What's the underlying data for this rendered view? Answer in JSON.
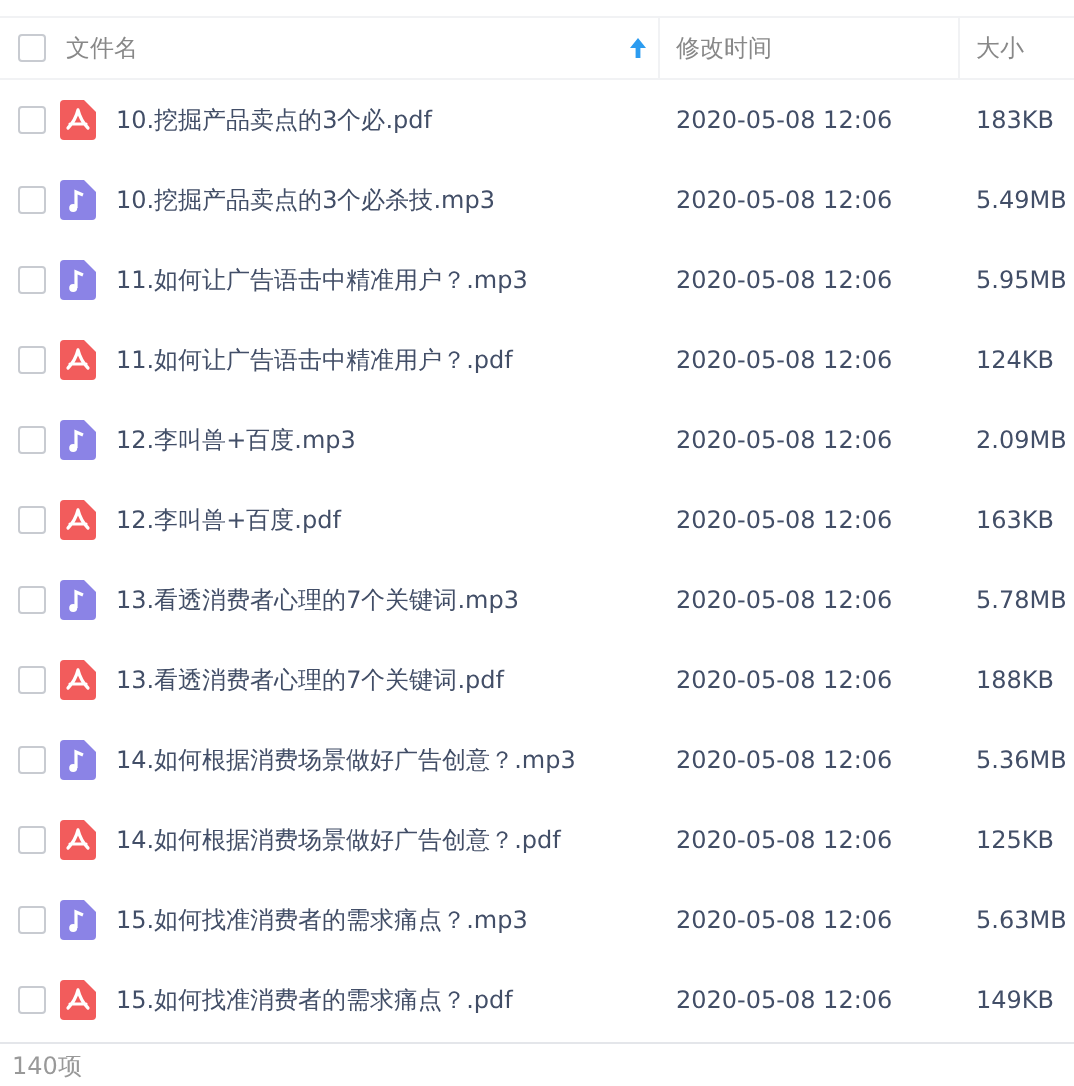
{
  "select_all": {
    "checked": false
  },
  "columns": [
    {
      "label": "文件名",
      "sorted": true
    },
    {
      "label": "修改时间",
      "sorted": false
    },
    {
      "label": "大小",
      "sorted": false
    }
  ],
  "rows": [
    {
      "kind": "pdf",
      "name": "10.挖掘产品卖点的3个必.pdf",
      "modified": "2020-05-08 12:06",
      "size": "183KB",
      "checked": false
    },
    {
      "kind": "mp3",
      "name": "10.挖掘产品卖点的3个必杀技.mp3",
      "modified": "2020-05-08 12:06",
      "size": "5.49MB",
      "checked": false
    },
    {
      "kind": "mp3",
      "name": "11.如何让广告语击中精准用户？.mp3",
      "modified": "2020-05-08 12:06",
      "size": "5.95MB",
      "checked": false
    },
    {
      "kind": "pdf",
      "name": "11.如何让广告语击中精准用户？.pdf",
      "modified": "2020-05-08 12:06",
      "size": "124KB",
      "checked": false
    },
    {
      "kind": "mp3",
      "name": "12.李叫兽+百度.mp3",
      "modified": "2020-05-08 12:06",
      "size": "2.09MB",
      "checked": false
    },
    {
      "kind": "pdf",
      "name": "12.李叫兽+百度.pdf",
      "modified": "2020-05-08 12:06",
      "size": "163KB",
      "checked": false
    },
    {
      "kind": "mp3",
      "name": "13.看透消费者心理的7个关键词.mp3",
      "modified": "2020-05-08 12:06",
      "size": "5.78MB",
      "checked": false
    },
    {
      "kind": "pdf",
      "name": "13.看透消费者心理的7个关键词.pdf",
      "modified": "2020-05-08 12:06",
      "size": "188KB",
      "checked": false
    },
    {
      "kind": "mp3",
      "name": "14.如何根据消费场景做好广告创意？.mp3",
      "modified": "2020-05-08 12:06",
      "size": "5.36MB",
      "checked": false
    },
    {
      "kind": "pdf",
      "name": "14.如何根据消费场景做好广告创意？.pdf",
      "modified": "2020-05-08 12:06",
      "size": "125KB",
      "checked": false
    },
    {
      "kind": "mp3",
      "name": "15.如何找准消费者的需求痛点？.mp3",
      "modified": "2020-05-08 12:06",
      "size": "5.63MB",
      "checked": false
    },
    {
      "kind": "pdf",
      "name": "15.如何找准消费者的需求痛点？.pdf",
      "modified": "2020-05-08 12:06",
      "size": "149KB",
      "checked": false
    }
  ],
  "status_bar": {
    "count": "140项"
  }
}
